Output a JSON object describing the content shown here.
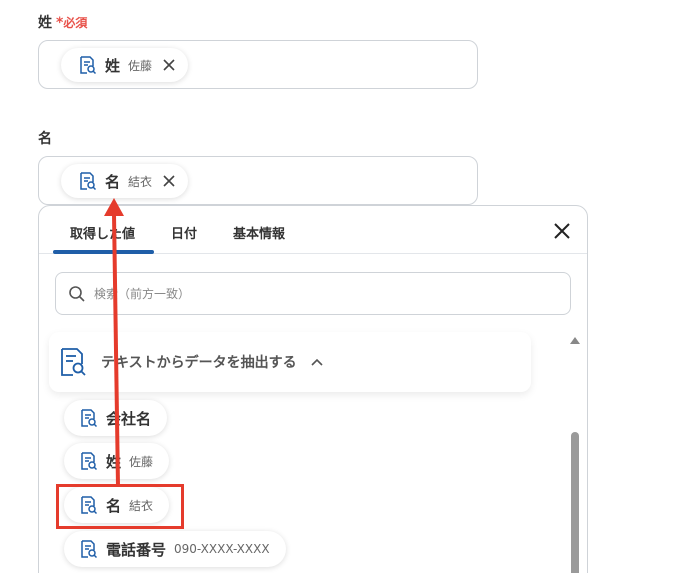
{
  "form": {
    "last_name": {
      "label": "姓",
      "required_star": "*",
      "required_text": "必須",
      "token": {
        "name": "姓",
        "value": "佐藤",
        "icon": "document-search-icon"
      }
    },
    "first_name": {
      "label": "名",
      "token": {
        "name": "名",
        "value": "結衣",
        "icon": "document-search-icon"
      }
    }
  },
  "picker": {
    "tabs": [
      "取得した値",
      "日付",
      "基本情報"
    ],
    "active_tab": "取得した値",
    "search": {
      "placeholder": "検索（前方一致）"
    },
    "section": {
      "title": "テキストからデータを抽出する",
      "expanded": true
    },
    "items": [
      {
        "name": "会社名",
        "value": ""
      },
      {
        "name": "姓",
        "value": "佐藤"
      },
      {
        "name": "名",
        "value": "結衣"
      },
      {
        "name": "電話番号",
        "value": "090-XXXX-XXXX"
      }
    ]
  },
  "colors": {
    "accent": "#1f5ea8",
    "required": "#e8524a",
    "annotation": "#e53b2c"
  }
}
